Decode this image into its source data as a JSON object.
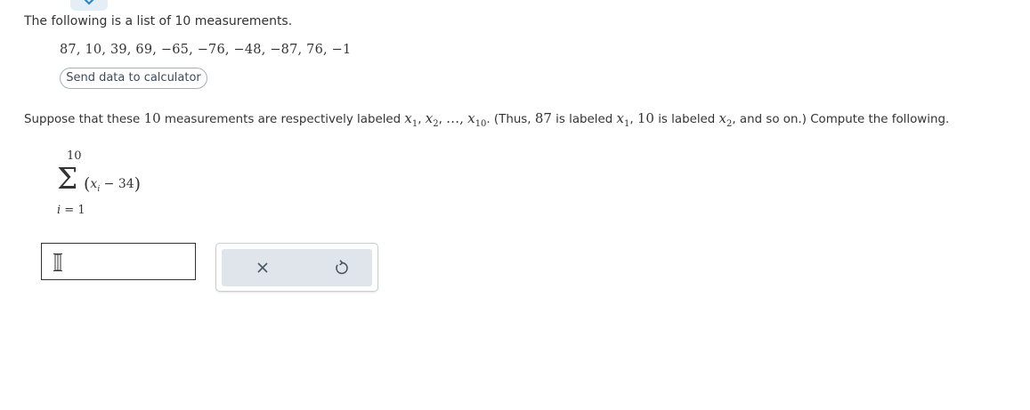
{
  "intro_text": "The following is a list of 10 measurements.",
  "measurements": "87, 10, 39, 69, −65, −76, −48, −87, 76, −1",
  "send_button_label": "Send data to calculator",
  "suppose": {
    "part1": "Suppose that these ",
    "count": "10",
    "part2": " measurements are respectively labeled ",
    "x": "x",
    "sub1": "1",
    "comma": ",",
    "sub2": "2",
    "ellipsis": "…,",
    "sub10": "10",
    "part3": ". (Thus, ",
    "val1": "87",
    "part4": " is labeled ",
    "part5": ", ",
    "val2": "10",
    "part6": " is labeled ",
    "part7": ", and so on.) Compute the following."
  },
  "summation": {
    "upper": "10",
    "sigma": "Σ",
    "open_paren": "(",
    "var": "x",
    "sub": "i",
    "minus_const": " − 34",
    "close_paren": ")",
    "lower_var": "i",
    "lower_eq": " = 1"
  },
  "answer": {
    "value": ""
  },
  "icons": {
    "top_tab": "chevron-down-icon",
    "answer_cursor": "text-cursor-icon",
    "clear": "close-icon",
    "undo": "undo-icon"
  },
  "colors": {
    "text": "#333333",
    "accent": "#2f86c9",
    "toolbar_bg": "#dfe5ea",
    "button_border": "#a8b0b7"
  }
}
